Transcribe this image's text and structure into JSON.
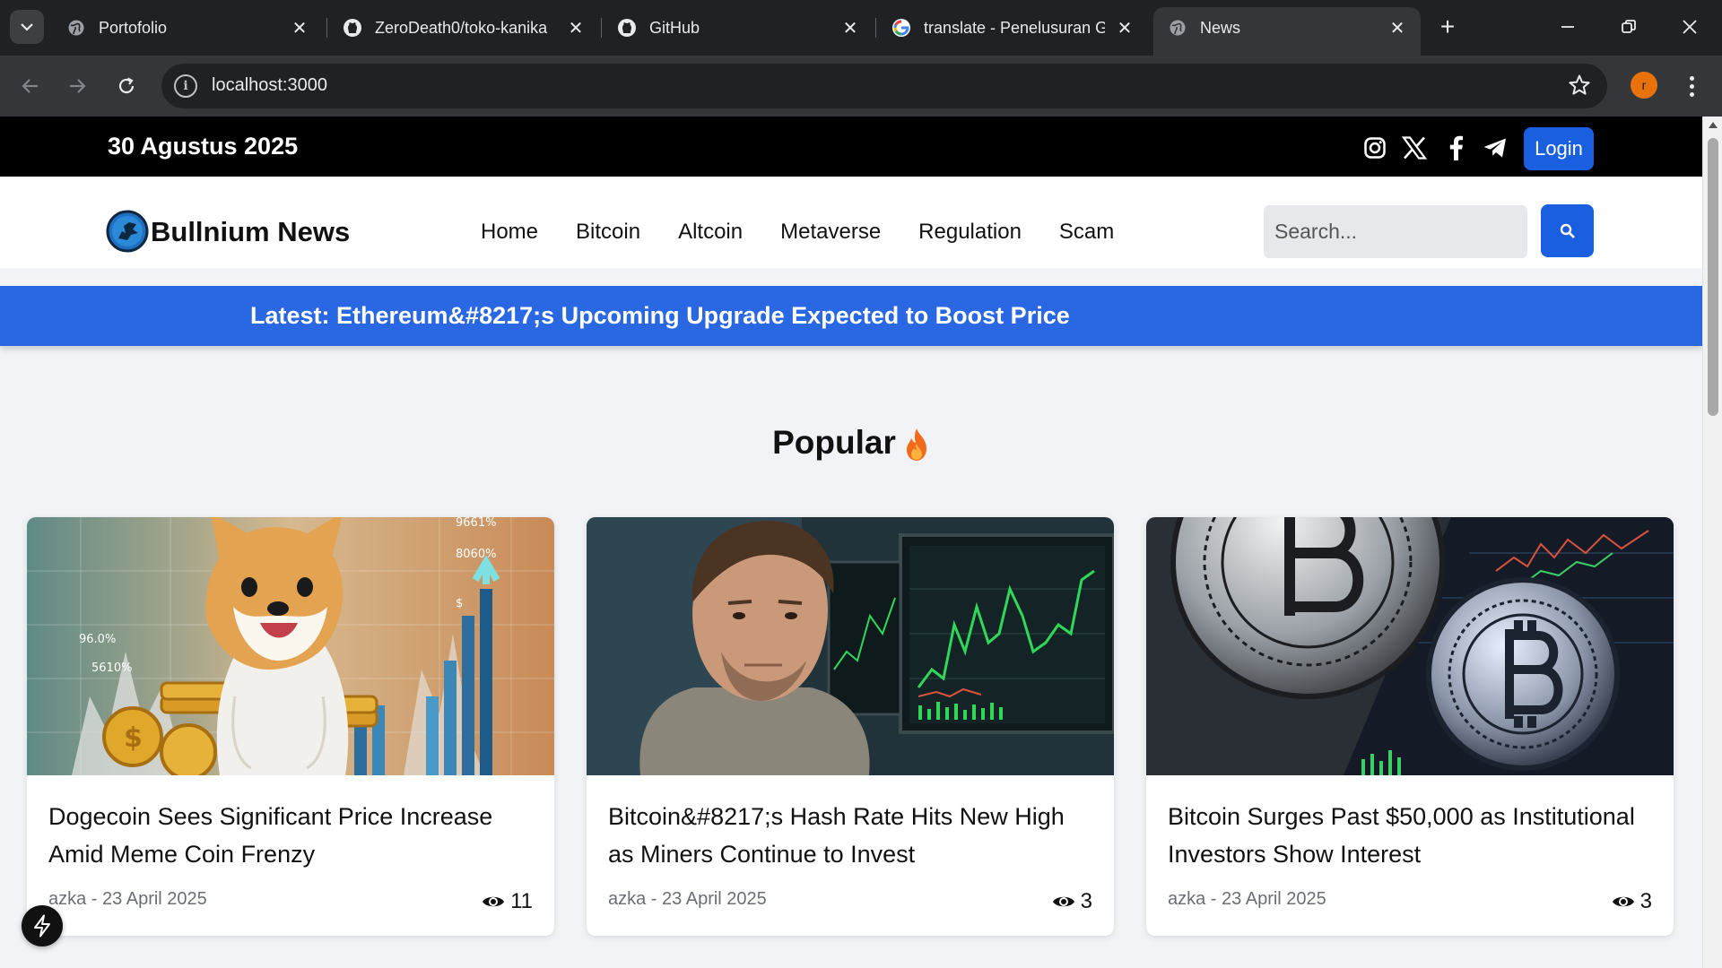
{
  "browser": {
    "tabs": [
      {
        "title": "Portofolio",
        "favicon": "globe-icon",
        "active": false
      },
      {
        "title": "ZeroDeath0/toko-kanika",
        "favicon": "github-icon",
        "active": false
      },
      {
        "title": "GitHub",
        "favicon": "github-icon",
        "active": false
      },
      {
        "title": "translate - Penelusuran G",
        "favicon": "google-icon",
        "active": false
      },
      {
        "title": "News",
        "favicon": "globe-icon",
        "active": true
      }
    ],
    "close_glyph": "✕",
    "new_tab_glyph": "+",
    "url": "localhost:3000",
    "profile_initial": "r"
  },
  "topbar": {
    "date": "30 Agustus 2025",
    "socials": [
      "instagram-icon",
      "x-icon",
      "facebook-icon",
      "telegram-icon"
    ],
    "login_label": "Login"
  },
  "navbar": {
    "brand": "Bullnium News",
    "links": [
      "Home",
      "Bitcoin",
      "Altcoin",
      "Metaverse",
      "Regulation",
      "Scam"
    ],
    "search_placeholder": "Search..."
  },
  "ticker": {
    "text": "Latest: Ethereum&#8217;s Upcoming Upgrade Expected to Boost Price"
  },
  "popular": {
    "title": "Popular",
    "cards": [
      {
        "title": "Dogecoin Sees Significant Price Increase Amid Meme Coin Frenzy",
        "author": "azka",
        "date": "23 April 2025",
        "views": "11",
        "chart_labels": [
          "9661%",
          "8060%",
          "96.0%",
          "5610%",
          "$"
        ]
      },
      {
        "title": "Bitcoin&#8217;s Hash Rate Hits New High as Miners Continue to Invest",
        "author": "azka",
        "date": "23 April 2025",
        "views": "3"
      },
      {
        "title": "Bitcoin Surges Past $50,000 as Institutional Investors Show Interest",
        "author": "azka",
        "date": "23 April 2025",
        "views": "3"
      }
    ]
  },
  "colors": {
    "accent": "#2a67e3",
    "button": "#1a5fe0",
    "topbar": "#000000",
    "chrome": "#202124"
  }
}
